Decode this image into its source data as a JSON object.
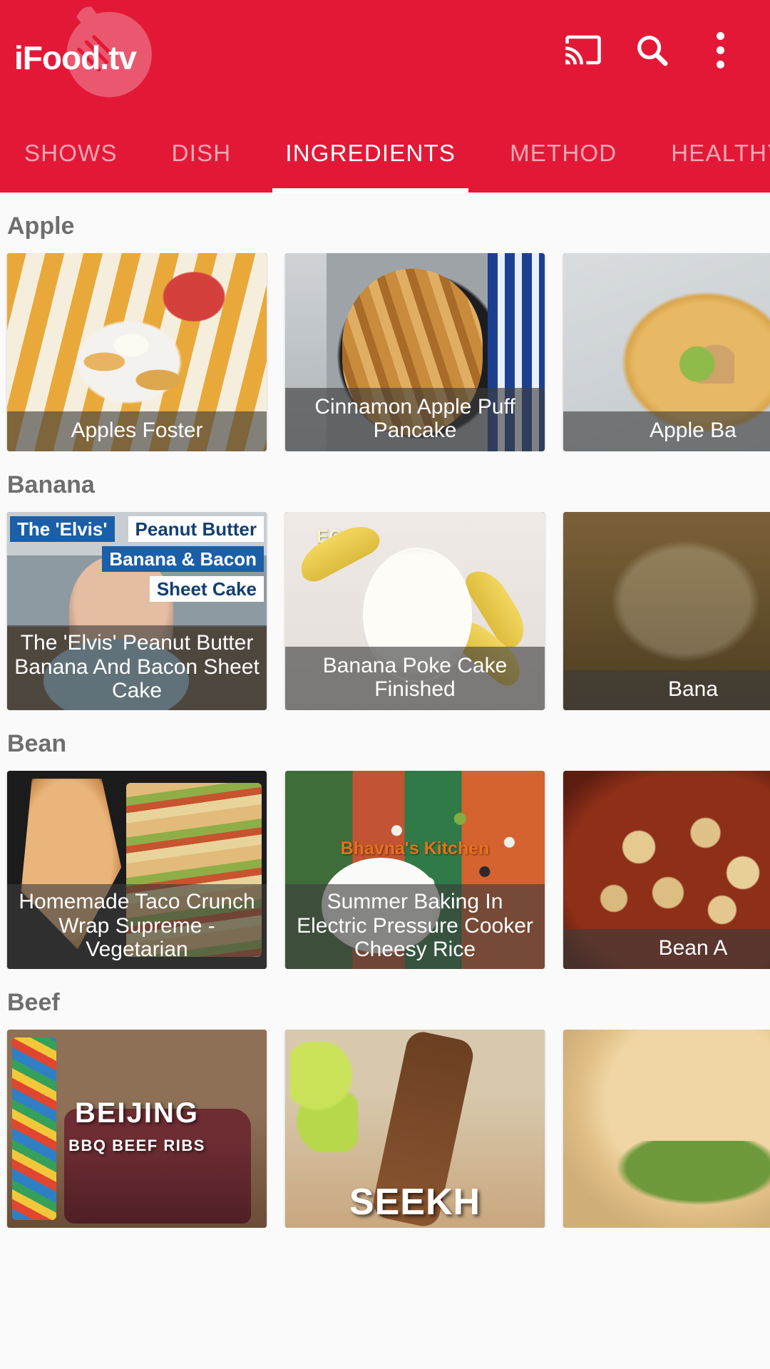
{
  "app": {
    "brand_name": "iFood.tv",
    "brand_color": "#e31837",
    "accent_text_color": "#ffffff",
    "section_title_color": "#6e6e6e"
  },
  "appbar": {
    "cast_icon": "cast-icon",
    "search_icon": "search-icon",
    "overflow_icon": "overflow-menu-icon"
  },
  "tabs": [
    {
      "label": "SHOWS",
      "active": false
    },
    {
      "label": "DISH",
      "active": false
    },
    {
      "label": "INGREDIENTS",
      "active": true
    },
    {
      "label": "METHOD",
      "active": false
    },
    {
      "label": "HEALTHY",
      "active": false
    }
  ],
  "sections": [
    {
      "title": "Apple",
      "cards": [
        {
          "caption": "Apples Foster"
        },
        {
          "caption": "Cinnamon Apple Puff Pancake"
        },
        {
          "caption": "Apple Ba"
        }
      ]
    },
    {
      "title": "Banana",
      "cards": [
        {
          "caption": "The 'Elvis' Peanut Butter Banana And Bacon Sheet Cake"
        },
        {
          "caption": "Banana Poke Cake Finished"
        },
        {
          "caption": "Bana"
        }
      ]
    },
    {
      "title": "Bean",
      "cards": [
        {
          "caption": "Homemade Taco Crunch Wrap Supreme - Vegetarian"
        },
        {
          "caption": "Summer Baking In Electric Pressure Cooker Cheesy Rice"
        },
        {
          "caption": "Bean A"
        }
      ]
    },
    {
      "title": "Beef",
      "cards": [
        {
          "caption": ""
        },
        {
          "caption": ""
        },
        {
          "caption": ""
        }
      ]
    }
  ],
  "thumb_text": {
    "elvis_line1": "The 'Elvis'",
    "elvis_line2": "Peanut Butter",
    "elvis_line3": "Banana & Bacon",
    "elvis_line4": "Sheet Cake",
    "summer_watermark": "Bhavna's Kitchen",
    "beijing_title": "BEIJING",
    "beijing_subtitle": "BBQ BEEF RIBS",
    "seekh_title": "SEEKH"
  }
}
